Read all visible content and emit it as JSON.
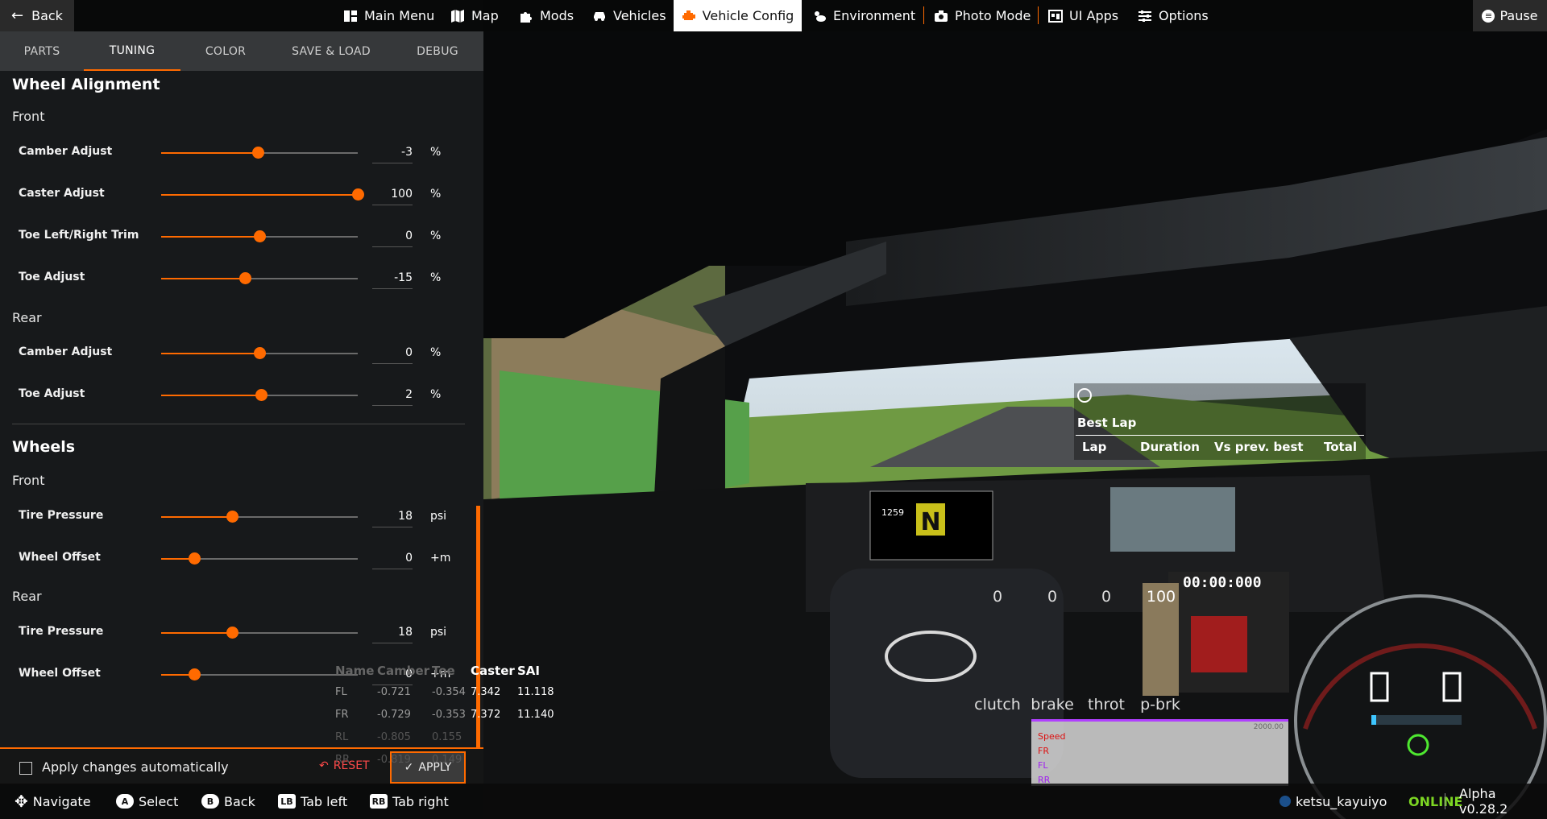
{
  "topbar": {
    "back_label": "Back",
    "pause_label": "Pause",
    "nav": [
      {
        "label": "Main Menu",
        "icon": "main-menu-icon"
      },
      {
        "label": "Map",
        "icon": "map-icon"
      },
      {
        "label": "Mods",
        "icon": "puzzle-icon"
      },
      {
        "label": "Vehicles",
        "icon": "car-icon"
      },
      {
        "label": "Vehicle Config",
        "icon": "engine-icon",
        "active": true
      },
      {
        "label": "Environment",
        "icon": "weather-icon"
      },
      {
        "label": "Photo Mode",
        "icon": "camera-icon"
      },
      {
        "label": "UI Apps",
        "icon": "ui-apps-icon"
      },
      {
        "label": "Options",
        "icon": "sliders-icon"
      }
    ]
  },
  "panel": {
    "tabs": [
      "PARTS",
      "TUNING",
      "COLOR",
      "SAVE & LOAD",
      "DEBUG"
    ],
    "active_tab": "TUNING",
    "wheel_alignment": {
      "title": "Wheel Alignment",
      "front_label": "Front",
      "front": [
        {
          "label": "Camber Adjust",
          "value": "-3",
          "unit": "%",
          "fraction": 0.49
        },
        {
          "label": "Caster Adjust",
          "value": "100",
          "unit": "%",
          "fraction": 1.0
        },
        {
          "label": "Toe Left/Right Trim",
          "value": "0",
          "unit": "%",
          "fraction": 0.5
        },
        {
          "label": "Toe Adjust",
          "value": "-15",
          "unit": "%",
          "fraction": 0.425
        }
      ],
      "rear_label": "Rear",
      "rear": [
        {
          "label": "Camber Adjust",
          "value": "0",
          "unit": "%",
          "fraction": 0.5
        },
        {
          "label": "Toe Adjust",
          "value": "2",
          "unit": "%",
          "fraction": 0.51
        }
      ]
    },
    "wheels": {
      "title": "Wheels",
      "front_label": "Front",
      "front": [
        {
          "label": "Tire Pressure",
          "value": "18",
          "unit": "psi",
          "fraction": 0.36
        },
        {
          "label": "Wheel Offset",
          "value": "0",
          "unit": "+m",
          "fraction": 0.17
        }
      ],
      "rear_label": "Rear",
      "rear": [
        {
          "label": "Tire Pressure",
          "value": "18",
          "unit": "psi",
          "fraction": 0.36
        },
        {
          "label": "Wheel Offset",
          "value": "0",
          "unit": "+m",
          "fraction": 0.17
        }
      ]
    },
    "footer": {
      "auto_apply_label": "Apply changes automatically",
      "reset_label": "RESET",
      "apply_label": "APPLY"
    }
  },
  "bottombar": {
    "hints": [
      {
        "key": "✥",
        "label": "Navigate"
      },
      {
        "key": "A",
        "label": "Select"
      },
      {
        "key": "B",
        "label": "Back"
      },
      {
        "key": "LB",
        "label": "Tab left"
      },
      {
        "key": "RB",
        "label": "Tab right"
      }
    ],
    "username": "ketsu_kayuiyo",
    "status": "ONLINE",
    "version": "Alpha v0.28.2"
  },
  "hud": {
    "best_lap": {
      "title": "Best Lap",
      "columns": [
        "Lap",
        "Duration",
        "Vs prev. best",
        "Total"
      ]
    },
    "pedals": {
      "values": [
        "0",
        "0",
        "0",
        "100"
      ],
      "labels": [
        "clutch",
        "brake",
        "throt",
        "p-brk"
      ]
    },
    "wheel_table": {
      "headers": [
        "Name",
        "Camber",
        "Toe",
        "Caster",
        "SAI"
      ],
      "rows": [
        {
          "name": "FL",
          "camber": "-0.721",
          "toe": "-0.354",
          "caster": "7.342",
          "sai": "11.118"
        },
        {
          "name": "FR",
          "camber": "-0.729",
          "toe": "-0.353",
          "caster": "7.372",
          "sai": "11.140"
        },
        {
          "name": "RL",
          "camber": "-0.805",
          "toe": "0.155"
        },
        {
          "name": "RR",
          "camber": "-0.819",
          "toe": "0.149"
        }
      ]
    },
    "graph": {
      "labels": [
        "Speed",
        "FR",
        "FL",
        "RR"
      ],
      "max_label": "2000.00"
    },
    "dash": {
      "timer": "00:00:000",
      "gear": "N",
      "gear_right": "0",
      "rpm": "1259"
    }
  }
}
